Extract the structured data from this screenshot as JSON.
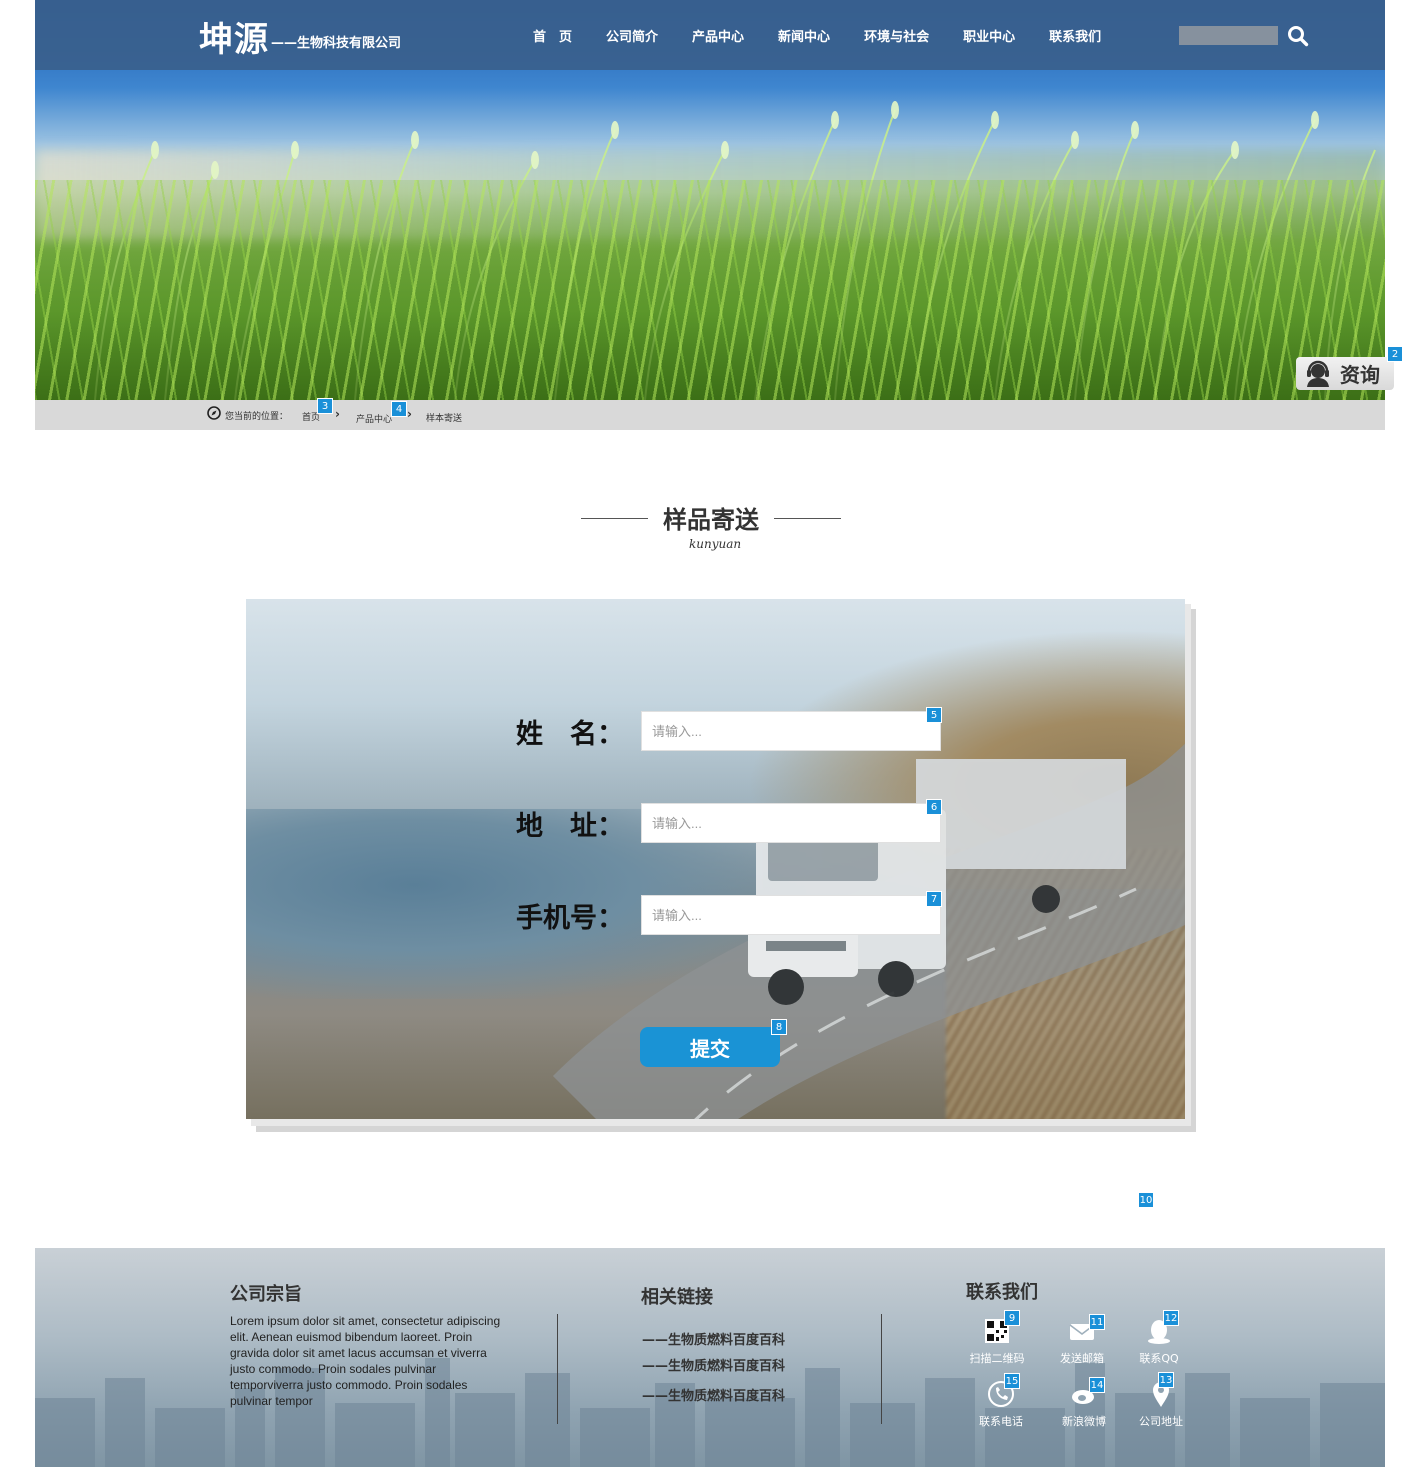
{
  "header": {
    "logo_main": "坤源",
    "logo_sub": "——生物科技有限公司",
    "nav": [
      "首　页",
      "公司简介",
      "产品中心",
      "新闻中心",
      "环境与社会",
      "职业中心",
      "联系我们"
    ],
    "search_placeholder": ""
  },
  "consult_button": {
    "label": "资询"
  },
  "breadcrumb": {
    "prefix": "您当前的位置：",
    "items": [
      "首页",
      "产品中心",
      "样本寄送"
    ]
  },
  "section": {
    "title": "样品寄送",
    "subtitle": "kunyuan"
  },
  "form": {
    "fields": [
      {
        "label": "姓　名：",
        "placeholder": "请输入..."
      },
      {
        "label": "地　址：",
        "placeholder": "请输入..."
      },
      {
        "label": "手机号：",
        "placeholder": "请输入..."
      }
    ],
    "submit_label": "提交"
  },
  "footer": {
    "about": {
      "title": "公司宗旨",
      "text": "Lorem ipsum dolor sit amet, consectetur adipiscing elit. Aenean euismod bibendum laoreet. Proin gravida dolor sit amet lacus accumsan et viverra justo commodo. Proin sodales pulvinar temporviverra justo commodo. Proin sodales pulvinar tempor"
    },
    "links": {
      "title": "相关链接",
      "items": [
        "——生物质燃料百度百科",
        "——生物质燃料百度百科",
        "——生物质燃料百度百科"
      ]
    },
    "contact": {
      "title": "联系我们",
      "items": [
        {
          "label": "扫描二维码",
          "icon": "qr-code-icon"
        },
        {
          "label": "发送邮箱",
          "icon": "mail-icon"
        },
        {
          "label": "联系QQ",
          "icon": "qq-icon"
        },
        {
          "label": "联系电话",
          "icon": "phone-icon"
        },
        {
          "label": "新浪微博",
          "icon": "weibo-icon"
        },
        {
          "label": "公司地址",
          "icon": "location-icon"
        }
      ]
    }
  },
  "markers": [
    "2",
    "3",
    "4",
    "5",
    "6",
    "7",
    "8",
    "9",
    "10",
    "11",
    "12",
    "13",
    "14",
    "15"
  ],
  "colors": {
    "topbar": "#3a5f8c",
    "accent": "#1a93d5",
    "breadcrumb_bg": "#d9d9d9"
  }
}
